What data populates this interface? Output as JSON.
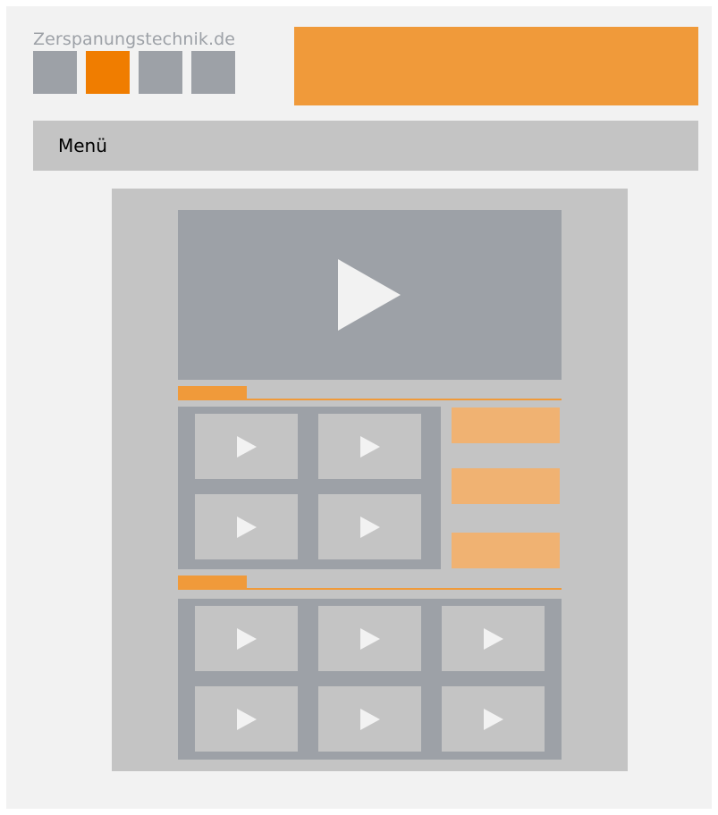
{
  "site": {
    "logo_text": "Zerspanungstechnik.de"
  },
  "colors": {
    "page_bg": "#f2f2f2",
    "gray_dark": "#9da1a7",
    "gray_light": "#c4c4c4",
    "orange": "#f09a3a",
    "orange_active": "#f07d00",
    "orange_light": "#f0b272"
  },
  "language_boxes": [
    {
      "name": "language-box-1",
      "active": false
    },
    {
      "name": "language-box-2",
      "active": true
    },
    {
      "name": "language-box-3",
      "active": false
    },
    {
      "name": "language-box-4",
      "active": false
    }
  ],
  "menu": {
    "label": "Menü"
  },
  "main_video": {
    "icon": "play-icon"
  },
  "section1": {
    "thumbnails": [
      "play-icon",
      "play-icon",
      "play-icon",
      "play-icon"
    ],
    "side_items": 3
  },
  "section2": {
    "thumbnails": [
      "play-icon",
      "play-icon",
      "play-icon",
      "play-icon",
      "play-icon",
      "play-icon"
    ]
  }
}
